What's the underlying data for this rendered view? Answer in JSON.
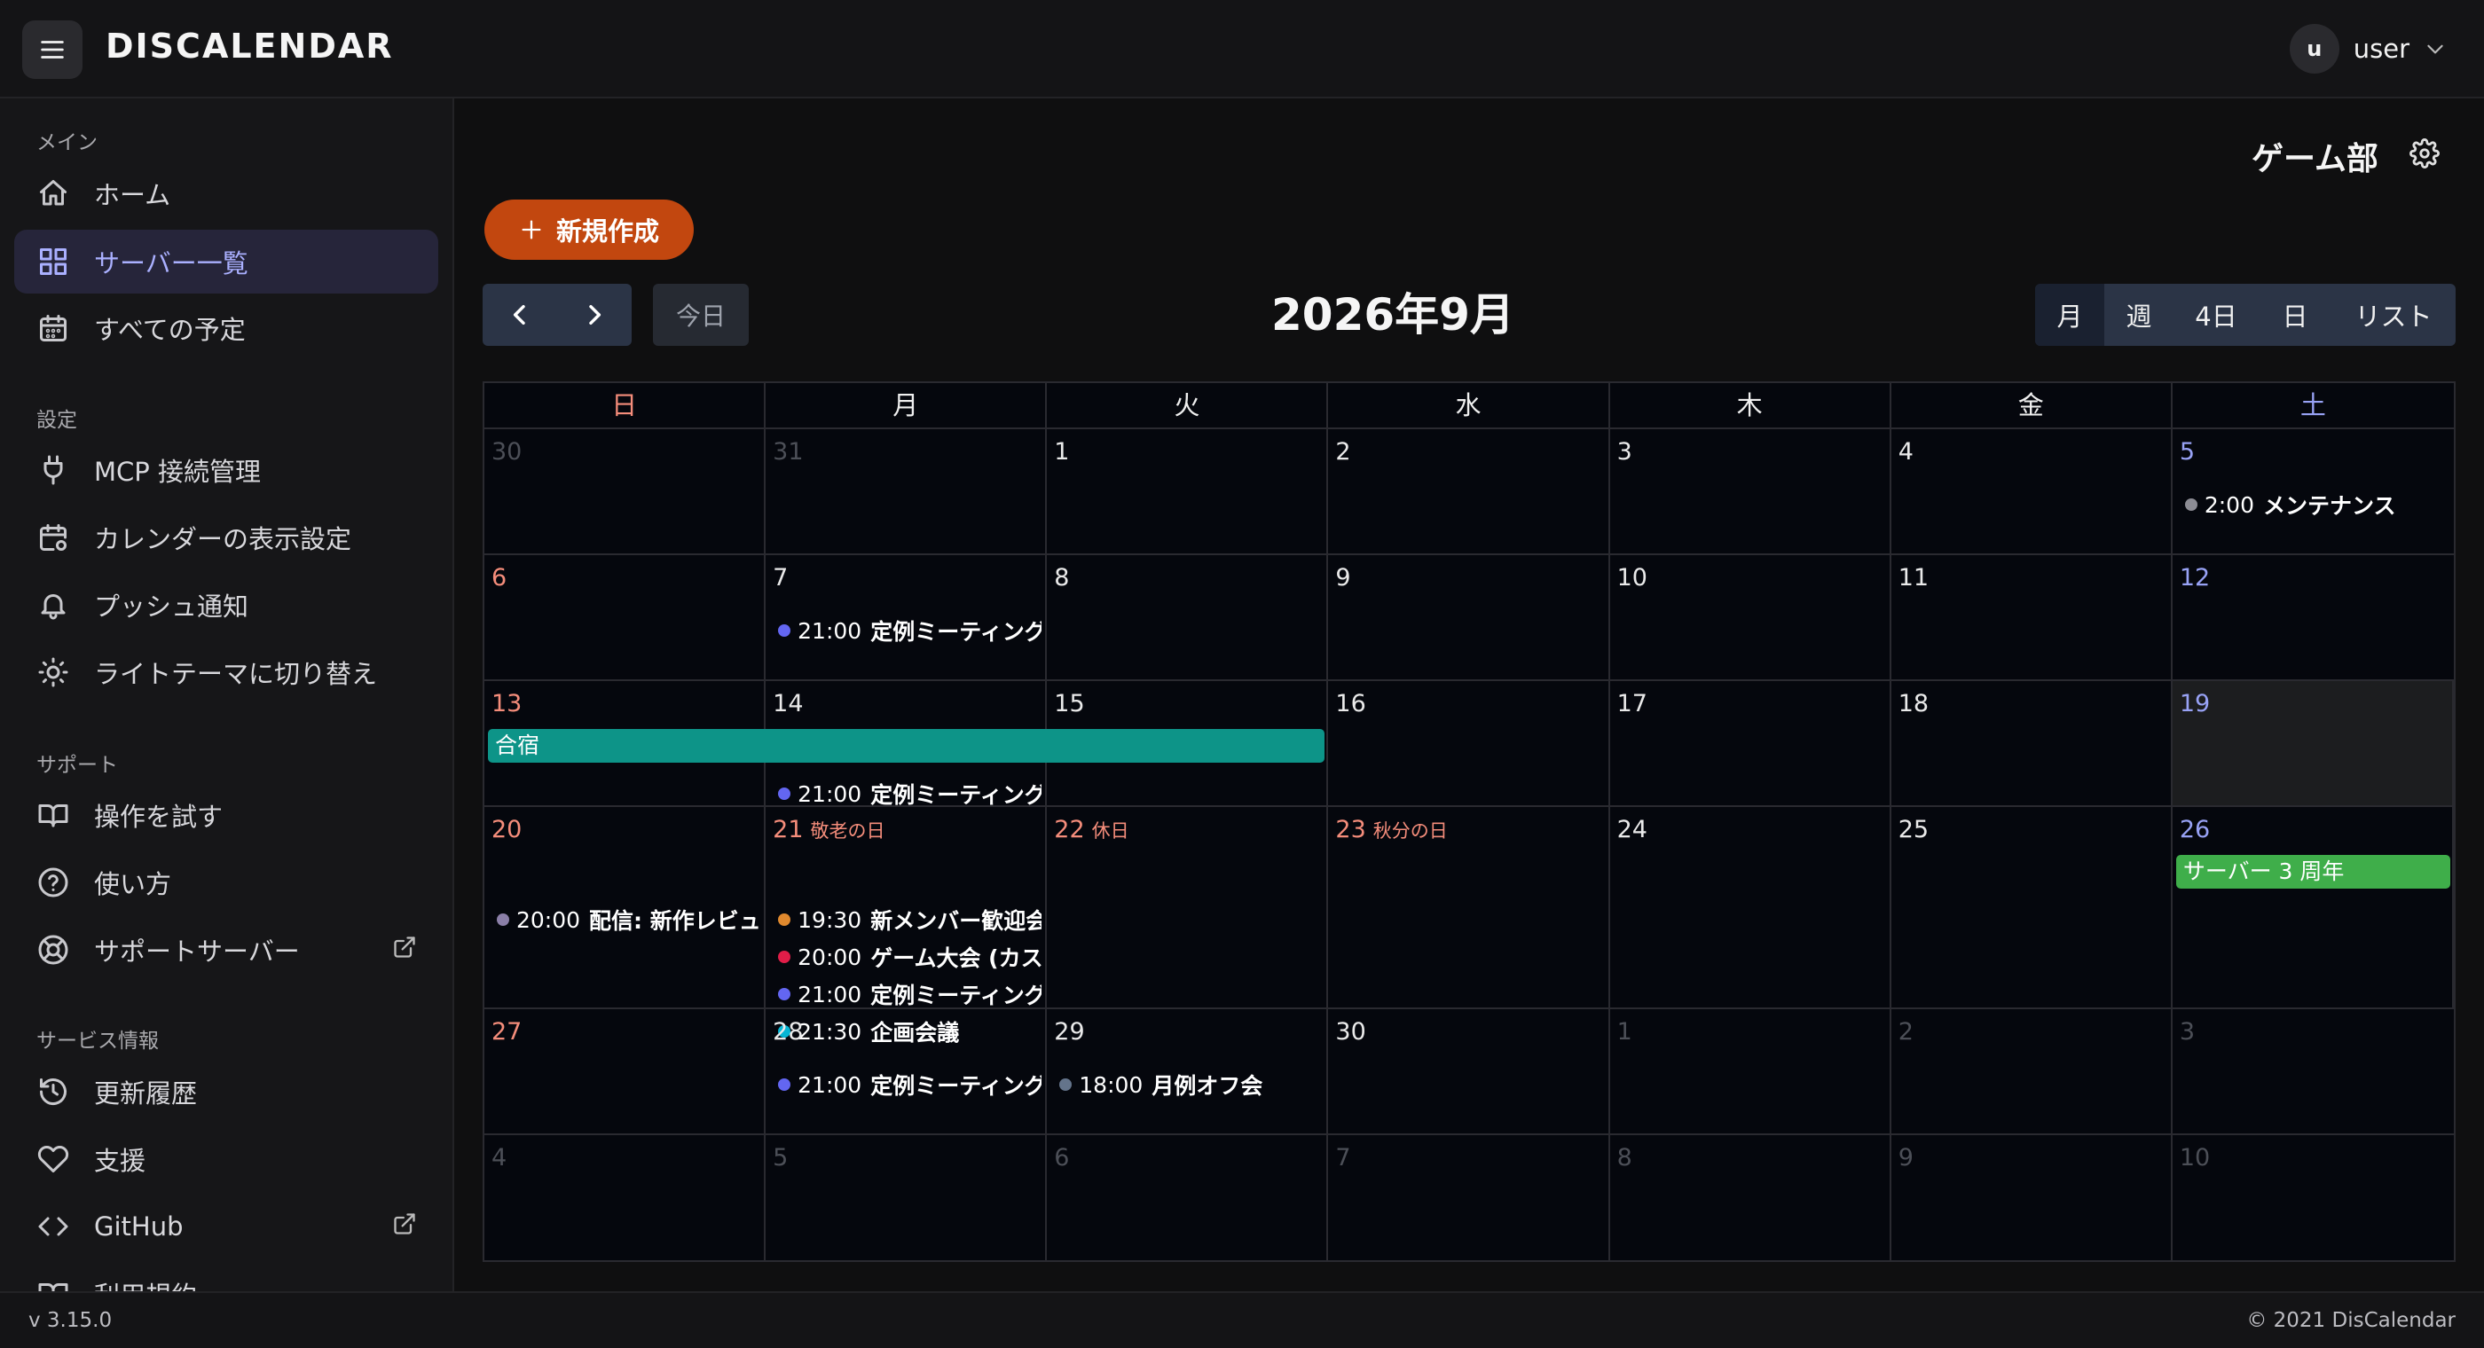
{
  "header": {
    "brand": "DISCALENDAR",
    "user_initial": "u",
    "user_name": "user"
  },
  "sidebar": {
    "sections": [
      {
        "title": "メイン",
        "items": [
          {
            "label": "ホーム",
            "icon": "home-icon"
          },
          {
            "label": "サーバー一覧",
            "icon": "grid-icon",
            "active": true
          },
          {
            "label": "すべての予定",
            "icon": "calendar-icon"
          }
        ]
      },
      {
        "title": "設定",
        "items": [
          {
            "label": "MCP 接続管理",
            "icon": "plug-icon"
          },
          {
            "label": "カレンダーの表示設定",
            "icon": "calendar-settings-icon"
          },
          {
            "label": "プッシュ通知",
            "icon": "bell-icon"
          },
          {
            "label": "ライトテーマに切り替え",
            "icon": "sun-icon"
          }
        ]
      },
      {
        "title": "サポート",
        "items": [
          {
            "label": "操作を試す",
            "icon": "book-icon"
          },
          {
            "label": "使い方",
            "icon": "help-circle-icon"
          },
          {
            "label": "サポートサーバー",
            "icon": "lifebuoy-icon",
            "external": true
          }
        ]
      },
      {
        "title": "サービス情報",
        "items": [
          {
            "label": "更新履歴",
            "icon": "history-icon"
          },
          {
            "label": "支援",
            "icon": "heart-icon"
          },
          {
            "label": "GitHub",
            "icon": "code-icon",
            "external": true
          },
          {
            "label": "利用規約",
            "icon": "book-icon"
          }
        ]
      }
    ]
  },
  "footer": {
    "version": "v 3.15.0",
    "copyright": "© 2021 DisCalendar"
  },
  "main": {
    "server_name": "ゲーム部",
    "new_button": "新規作成",
    "today_button": "今日",
    "month_title": "2026年9月",
    "views": [
      {
        "label": "月",
        "active": true
      },
      {
        "label": "週"
      },
      {
        "label": "4日"
      },
      {
        "label": "日"
      },
      {
        "label": "リスト"
      }
    ]
  },
  "calendar": {
    "weekdays": [
      "日",
      "月",
      "火",
      "水",
      "木",
      "金",
      "土"
    ],
    "weeks": [
      {
        "days": [
          {
            "num": "30",
            "other": true
          },
          {
            "num": "31",
            "other": true
          },
          {
            "num": "1"
          },
          {
            "num": "2"
          },
          {
            "num": "3"
          },
          {
            "num": "4"
          },
          {
            "num": "5",
            "events": [
              {
                "time": "2:00",
                "title": "メンテナンス",
                "color": "#8c8c94"
              }
            ]
          }
        ]
      },
      {
        "days": [
          {
            "num": "6"
          },
          {
            "num": "7",
            "events": [
              {
                "time": "21:00",
                "title": "定例ミーティング",
                "color": "#6366f1"
              }
            ]
          },
          {
            "num": "8"
          },
          {
            "num": "9"
          },
          {
            "num": "10"
          },
          {
            "num": "11"
          },
          {
            "num": "12"
          }
        ]
      },
      {
        "allday": [
          {
            "title": "合宿",
            "start": 0,
            "span": 3,
            "color": "#0d9488"
          }
        ],
        "days": [
          {
            "num": "13"
          },
          {
            "num": "14",
            "events": [
              {
                "time": "21:00",
                "title": "定例ミーティング",
                "color": "#6366f1"
              }
            ]
          },
          {
            "num": "15"
          },
          {
            "num": "16"
          },
          {
            "num": "17"
          },
          {
            "num": "18"
          },
          {
            "num": "19",
            "today": true
          }
        ]
      },
      {
        "tall": true,
        "allday": [
          {
            "title": "サーバー 3 周年",
            "start": 6,
            "span": 1,
            "color": "#3fae4a"
          }
        ],
        "days": [
          {
            "num": "20",
            "events": [
              {
                "time": "20:00",
                "title": "配信: 新作レビュー",
                "color": "#8b7fa8"
              }
            ]
          },
          {
            "num": "21",
            "holiday": "敬老の日",
            "events": [
              {
                "time": "19:30",
                "title": "新メンバー歓迎会",
                "color": "#e0892e"
              },
              {
                "time": "20:00",
                "title": "ゲーム大会 (カスタム)",
                "color": "#e11d48"
              },
              {
                "time": "21:00",
                "title": "定例ミーティング",
                "color": "#6366f1"
              },
              {
                "time": "21:30",
                "title": "企画会議",
                "color": "#06b6d4"
              }
            ]
          },
          {
            "num": "22",
            "holiday": "休日"
          },
          {
            "num": "23",
            "holiday": "秋分の日"
          },
          {
            "num": "24"
          },
          {
            "num": "25"
          },
          {
            "num": "26"
          }
        ]
      },
      {
        "days": [
          {
            "num": "27"
          },
          {
            "num": "28",
            "events": [
              {
                "time": "21:00",
                "title": "定例ミーティング",
                "color": "#6366f1"
              }
            ]
          },
          {
            "num": "29",
            "events": [
              {
                "time": "18:00",
                "title": "月例オフ会",
                "color": "#64748b"
              }
            ]
          },
          {
            "num": "30"
          },
          {
            "num": "1",
            "other": true
          },
          {
            "num": "2",
            "other": true
          },
          {
            "num": "3",
            "other": true
          }
        ]
      },
      {
        "days": [
          {
            "num": "4",
            "other": true
          },
          {
            "num": "5",
            "other": true
          },
          {
            "num": "6",
            "other": true
          },
          {
            "num": "7",
            "other": true
          },
          {
            "num": "8",
            "other": true
          },
          {
            "num": "9",
            "other": true
          },
          {
            "num": "10",
            "other": true
          }
        ]
      }
    ]
  }
}
